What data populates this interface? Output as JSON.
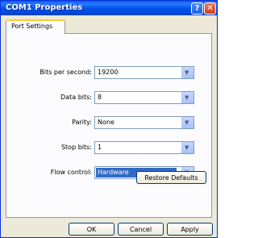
{
  "window": {
    "title": "COM1 Properties",
    "help_label": "?",
    "close_label": "✕"
  },
  "tabs": [
    {
      "label": "Port Settings",
      "active": true
    }
  ],
  "fields": [
    {
      "label": "Bits per second:",
      "value": "19200"
    },
    {
      "label": "Data bits:",
      "value": "8"
    },
    {
      "label": "Parity:",
      "value": "None"
    },
    {
      "label": "Stop bits:",
      "value": "1"
    },
    {
      "label": "Flow control:",
      "value": "Hardware",
      "selected": true
    }
  ],
  "buttons": {
    "restore": "Restore Defaults",
    "ok": "OK",
    "cancel": "Cancel",
    "apply": "Apply"
  },
  "icons": {
    "dropdown": "chevron-down-icon"
  },
  "colors": {
    "titlebar": "#0a58e8",
    "selection": "#316ac5",
    "tab_accent": "#ffc83c"
  }
}
